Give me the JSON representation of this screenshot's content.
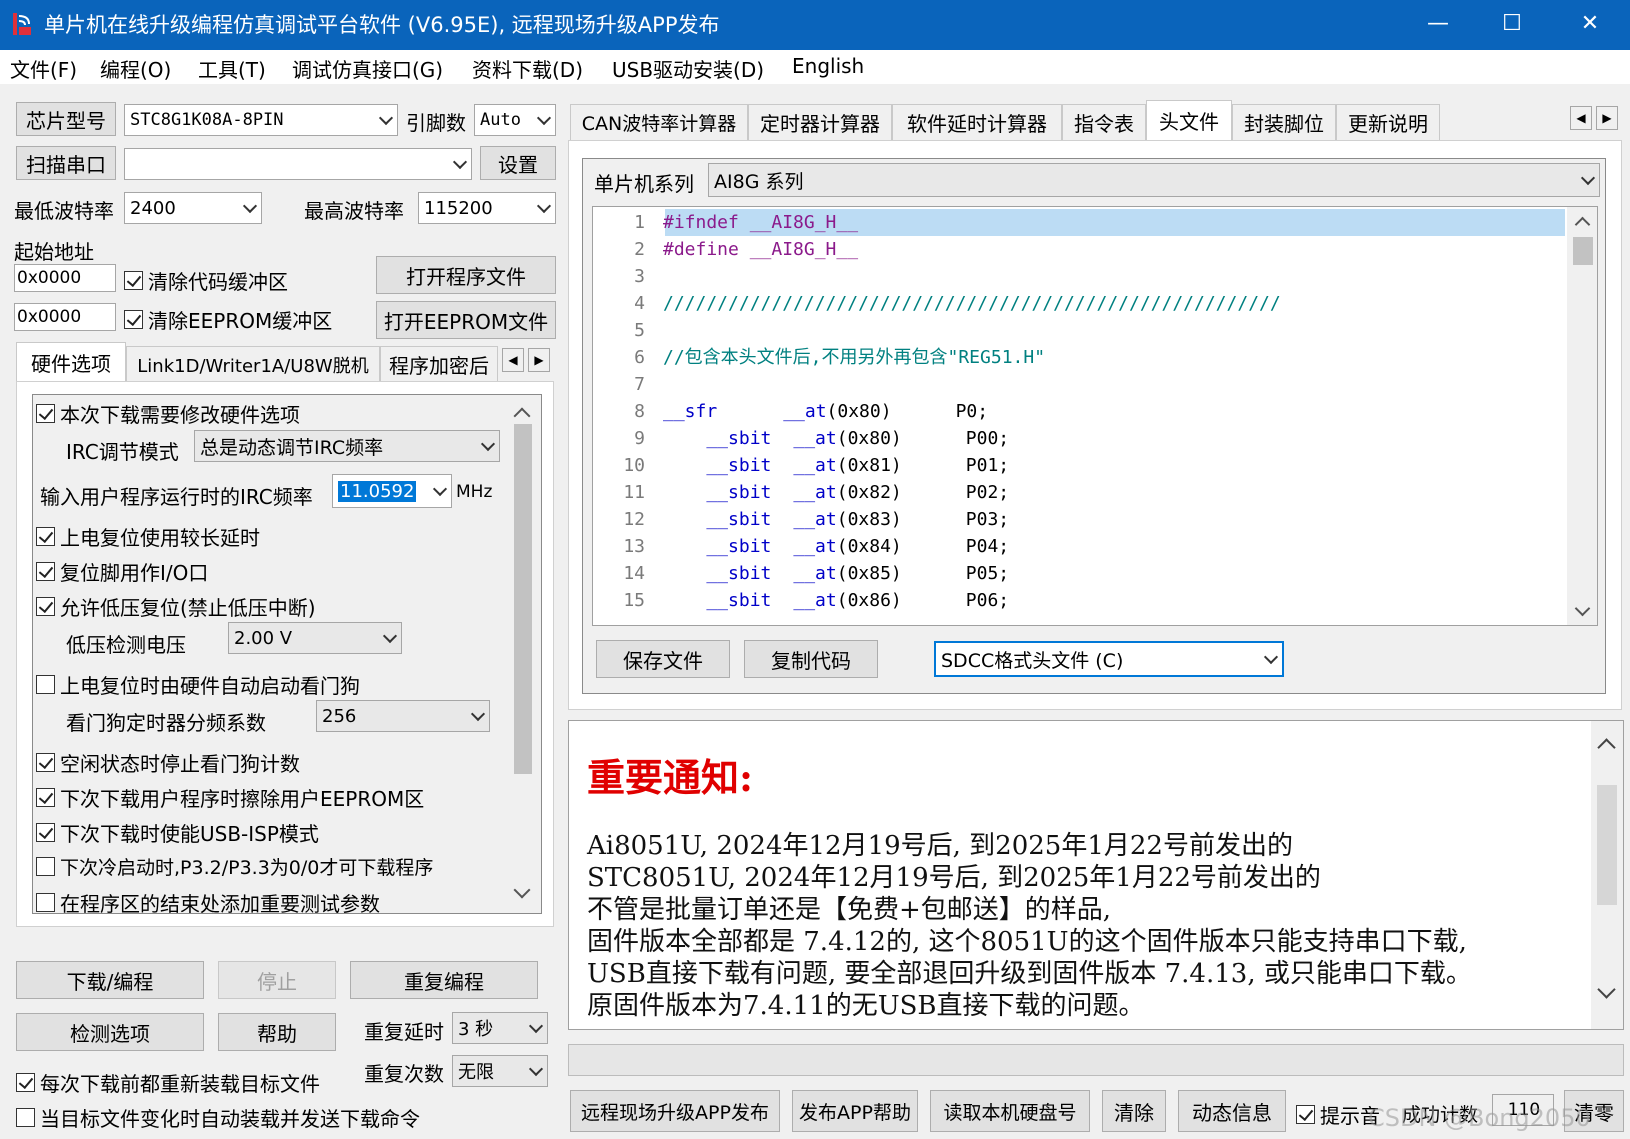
{
  "window": {
    "title": "单片机在线升级编程仿真调试平台软件 (V6.95E), 远程现场升级APP发布",
    "minimize": "—",
    "maximize": "☐",
    "close": "✕"
  },
  "menu": [
    "文件(F)",
    "编程(O)",
    "工具(T)",
    "调试仿真接口(G)",
    "资料下载(D)",
    "USB驱动安装(D)",
    "English"
  ],
  "left": {
    "chip_type_btn": "芯片型号",
    "chip_value": "STC8G1K08A-8PIN",
    "pins_label": "引脚数",
    "pins_value": "Auto",
    "scan_port_btn": "扫描串口",
    "port_value": "",
    "settings_btn": "设置",
    "min_baud_label": "最低波特率",
    "min_baud_value": "2400",
    "max_baud_label": "最高波特率",
    "max_baud_value": "115200",
    "start_addr_label": "起始地址",
    "addr1": "0x0000",
    "clear_code": "清除代码缓冲区",
    "open_program": "打开程序文件",
    "addr2": "0x0000",
    "clear_eeprom": "清除EEPROM缓冲区",
    "open_eeprom": "打开EEPROM文件",
    "tabs": [
      "硬件选项",
      "Link1D/Writer1A/U8W脱机",
      "程序加密后"
    ],
    "options": {
      "modify_hw": "本次下载需要修改硬件选项",
      "irc_mode_label": "IRC调节模式",
      "irc_mode_value": "总是动态调节IRC频率",
      "irc_freq_label": "输入用户程序运行时的IRC频率",
      "irc_freq_value": "11.0592",
      "irc_unit": "MHz",
      "long_delay": "上电复位使用较长延时",
      "reset_io": "复位脚用作I/O口",
      "lvr": "允许低压复位(禁止低压中断)",
      "lvd_label": "低压检测电压",
      "lvd_value": "2.00 V",
      "wdt_auto": "上电复位时由硬件自动启动看门狗",
      "wdt_div_label": "看门狗定时器分频系数",
      "wdt_div_value": "256",
      "idle_stop_wdt": "空闲状态时停止看门狗计数",
      "erase_eeprom": "下次下载用户程序时擦除用户EEPROM区",
      "usb_isp": "下次下载时使能USB-ISP模式",
      "p32_p33": "下次冷启动时,P3.2/P3.3为0/0才可下载程序",
      "add_params": "在程序区的结束处添加重要测试参数"
    },
    "download_btn": "下载/编程",
    "stop_btn": "停止",
    "reprogram_btn": "重复编程",
    "check_btn": "检测选项",
    "help_btn": "帮助",
    "repeat_delay_label": "重复延时",
    "repeat_delay_value": "3 秒",
    "repeat_count_label": "重复次数",
    "repeat_count_value": "无限",
    "reload_each": "每次下载前都重新装载目标文件",
    "auto_reload": "当目标文件变化时自动装载并发送下载命令"
  },
  "right": {
    "tabs": [
      "CAN波特率计算器",
      "定时器计算器",
      "软件延时计算器",
      "指令表",
      "头文件",
      "封装脚位",
      "更新说明"
    ],
    "mcu_series_label": "单片机系列",
    "mcu_series_value": "AI8G 系列",
    "code": [
      {
        "n": "1",
        "t": "#ifndef __AI8G_H__"
      },
      {
        "n": "2",
        "t": "#define __AI8G_H__"
      },
      {
        "n": "3",
        "t": ""
      },
      {
        "n": "4",
        "t": "/////////////////////////////////////////////////////////"
      },
      {
        "n": "5",
        "t": ""
      },
      {
        "n": "6",
        "t": "//包含本头文件后,不用另外再包含\"REG51.H\""
      },
      {
        "n": "7",
        "t": ""
      },
      {
        "n": "8",
        "a": "__sfr",
        "b": "__at",
        "c": "(0x80)",
        "d": "P0;"
      },
      {
        "n": "9",
        "a": "    __sbit",
        "b": "__at",
        "c": "(0x80)",
        "d": "P00;"
      },
      {
        "n": "10",
        "a": "    __sbit",
        "b": "__at",
        "c": "(0x81)",
        "d": "P01;"
      },
      {
        "n": "11",
        "a": "    __sbit",
        "b": "__at",
        "c": "(0x82)",
        "d": "P02;"
      },
      {
        "n": "12",
        "a": "    __sbit",
        "b": "__at",
        "c": "(0x83)",
        "d": "P03;"
      },
      {
        "n": "13",
        "a": "    __sbit",
        "b": "__at",
        "c": "(0x84)",
        "d": "P04;"
      },
      {
        "n": "14",
        "a": "    __sbit",
        "b": "__at",
        "c": "(0x85)",
        "d": "P05;"
      },
      {
        "n": "15",
        "a": "    __sbit",
        "b": "__at",
        "c": "(0x86)",
        "d": "P06;"
      }
    ],
    "save_btn": "保存文件",
    "copy_btn": "复制代码",
    "format_value": "SDCC格式头文件 (C)",
    "notice_title": "重要通知:",
    "notice_lines": [
      "Ai8051U,  2024年12月19号后, 到2025年1月22号前发出的",
      "STC8051U, 2024年12月19号后, 到2025年1月22号前发出的",
      "不管是批量订单还是【免费+包邮送】的样品,",
      "固件版本全部都是 7.4.12的, 这个8051U的这个固件版本只能支持串口下载,",
      "USB直接下载有问题, 要全部退回升级到固件版本 7.4.13, 或只能串口下载。",
      "原固件版本为7.4.11的无USB直接下载的问题。"
    ],
    "bottom": {
      "remote_btn": "远程现场升级APP发布",
      "app_help_btn": "发布APP帮助",
      "read_disk_btn": "读取本机硬盘号",
      "clear_btn": "清除",
      "dyn_info_btn": "动态信息",
      "prompt_chk": "提示音",
      "success_label": "成功计数",
      "success_value": "110",
      "zero_btn": "清零"
    }
  },
  "colors": {
    "titlebar": "#0a64bb",
    "notice_title": "#e00000",
    "highlight_line": "#bcdcf4"
  },
  "watermark": "CSDN @Bong2050"
}
